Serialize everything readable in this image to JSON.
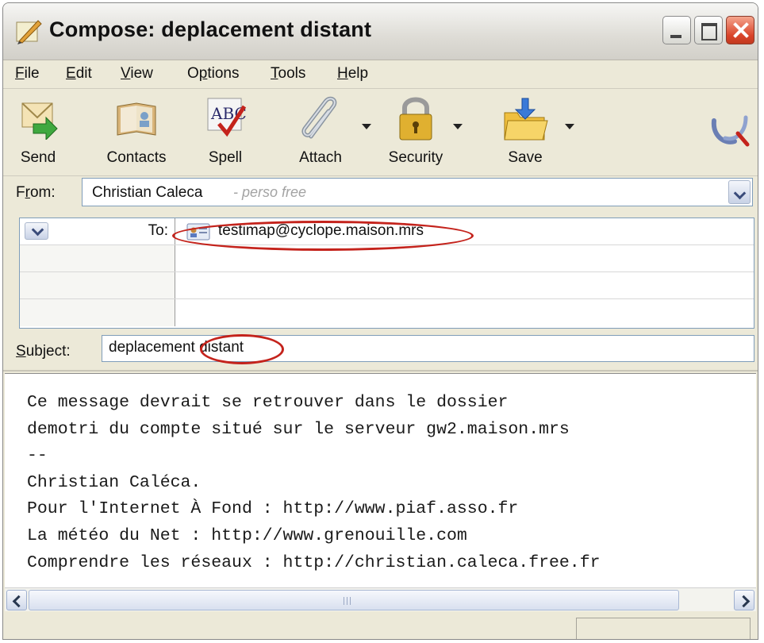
{
  "window": {
    "title": "Compose: deplacement distant"
  },
  "menu": [
    {
      "label": "File",
      "mnemonic": "F",
      "rest": "ile"
    },
    {
      "label": "Edit",
      "mnemonic": "E",
      "rest": "dit"
    },
    {
      "label": "View",
      "mnemonic": "V",
      "rest": "iew"
    },
    {
      "label": "Options",
      "pre": "O",
      "mnemonic": "p",
      "rest": "tions"
    },
    {
      "label": "Tools",
      "mnemonic": "T",
      "rest": "ools"
    },
    {
      "label": "Help",
      "mnemonic": "H",
      "rest": "elp"
    }
  ],
  "toolbar": {
    "send": "Send",
    "contacts": "Contacts",
    "spell": "Spell",
    "attach": "Attach",
    "security": "Security",
    "save": "Save"
  },
  "headers": {
    "from_label_pre": "F",
    "from_label_mnemonic": "r",
    "from_label_rest": "om:",
    "from_name": "Christian Caleca",
    "from_identity": "- perso free",
    "to_label": "To:",
    "to_address": "testimap@cyclope.maison.mrs",
    "subject_label_mnemonic": "S",
    "subject_label_rest": "ubject:",
    "subject_value": "deplacement distant"
  },
  "body": {
    "lines": [
      "Ce message devrait se retrouver dans le dossier",
      "demotri du compte situé sur le serveur gw2.maison.mrs",
      "--",
      "Christian Caléca.",
      "Pour l'Internet À Fond : http://www.piaf.asso.fr",
      "La météo du Net : http://www.grenouille.com",
      "Comprendre les réseaux : http://christian.caleca.free.fr"
    ]
  },
  "colors": {
    "highlight": "#c4231c",
    "window_bg": "#ece9d8",
    "identity_text": "#a3a3a3"
  },
  "icons": {
    "title": "compose-pen-icon",
    "send": "send-arrow-icon",
    "contacts": "address-book-icon",
    "spell": "spellcheck-icon",
    "attach": "paperclip-icon",
    "security": "padlock-icon",
    "save": "save-folder-icon",
    "throbber": "throbber-icon"
  }
}
